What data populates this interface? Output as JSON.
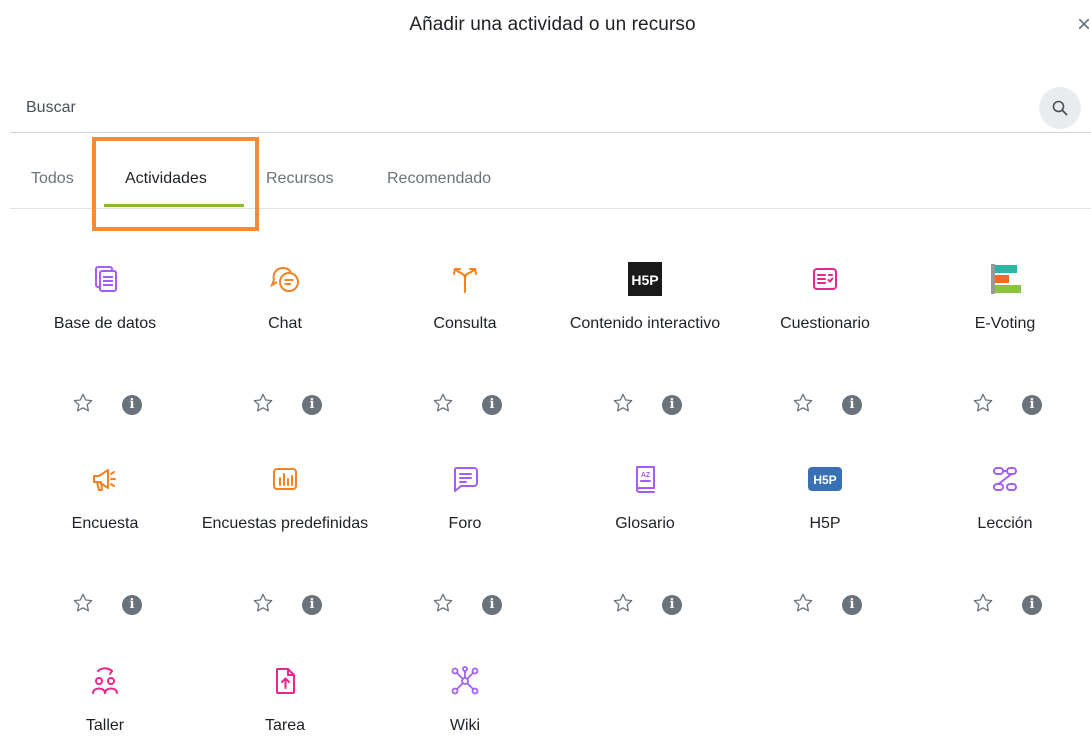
{
  "modal": {
    "title": "Añadir una actividad o un recurso",
    "close_symbol": "×"
  },
  "search": {
    "placeholder": "Buscar",
    "value": "",
    "icon": "search-icon"
  },
  "tabs": [
    {
      "label": "Todos",
      "active": false
    },
    {
      "label": "Actividades",
      "active": true
    },
    {
      "label": "Recursos",
      "active": false
    },
    {
      "label": "Recomendado",
      "active": false
    }
  ],
  "colors": {
    "tab_active_underline": "#8ab92d",
    "highlight_border": "#f78a33",
    "collaboration": "#a25ef7",
    "communication": "#f7811d",
    "assessment": "#e9268e",
    "interactive": "#3a71b5",
    "h5p_dark": "#1a1a1a",
    "muted": "#6a737b"
  },
  "activities": [
    {
      "name": "Base de datos",
      "icon": "database-icon"
    },
    {
      "name": "Chat",
      "icon": "chat-icon"
    },
    {
      "name": "Consulta",
      "icon": "choice-icon"
    },
    {
      "name": "Contenido interactivo",
      "icon": "h5p-logo-icon"
    },
    {
      "name": "Cuestionario",
      "icon": "quiz-icon"
    },
    {
      "name": "E-Voting",
      "icon": "evoting-icon"
    },
    {
      "name": "Encuesta",
      "icon": "megaphone-icon"
    },
    {
      "name": "Encuestas predefinidas",
      "icon": "survey-chart-icon"
    },
    {
      "name": "Foro",
      "icon": "forum-icon"
    },
    {
      "name": "Glosario",
      "icon": "glossary-icon"
    },
    {
      "name": "H5P",
      "icon": "h5p-badge-icon"
    },
    {
      "name": "Lección",
      "icon": "lesson-icon"
    },
    {
      "name": "Taller",
      "icon": "workshop-icon"
    },
    {
      "name": "Tarea",
      "icon": "assignment-icon"
    },
    {
      "name": "Wiki",
      "icon": "wiki-icon"
    }
  ],
  "item_actions": {
    "star_icon": "star-outline-icon",
    "info_icon": "info-icon",
    "info_glyph": "i"
  }
}
